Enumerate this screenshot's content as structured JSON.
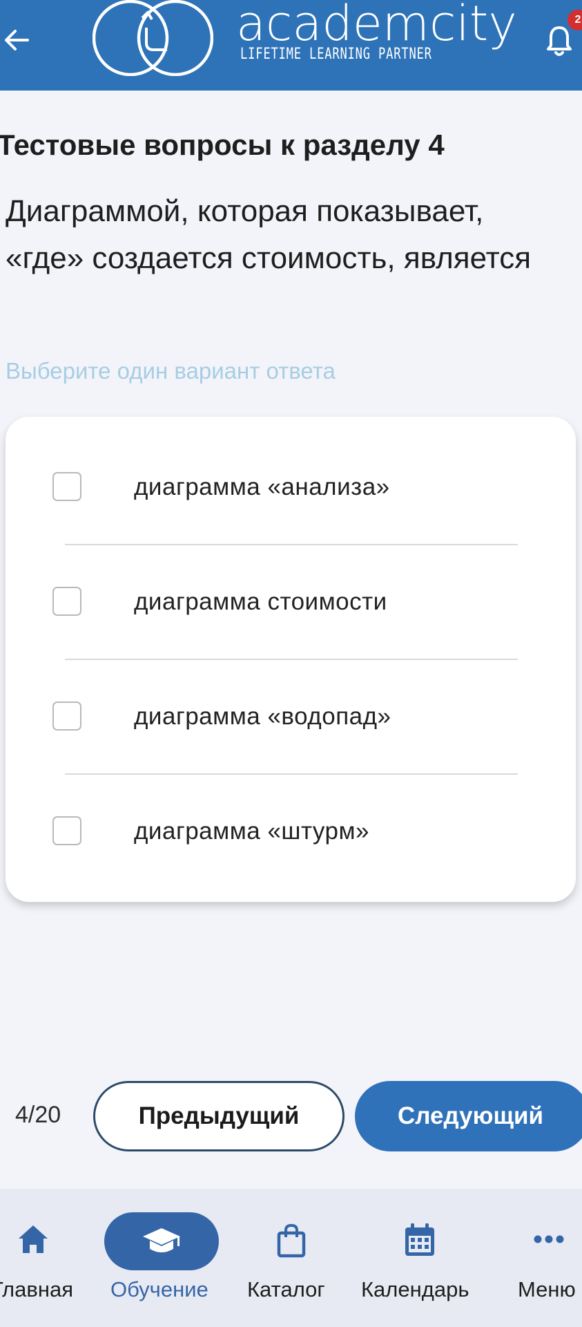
{
  "header": {
    "brand_name": "academcity",
    "brand_tagline": "LIFETIME LEARNING PARTNER",
    "notification_count": "2"
  },
  "quiz": {
    "section_title": "Тестовые вопросы к разделу 4",
    "question": "Диаграммой, которая показывает, «где» создается стоимость, является",
    "hint": "Выберите один вариант ответа",
    "options": [
      {
        "label": "диаграмма «анализа»",
        "checked": false
      },
      {
        "label": "диаграмма стоимости",
        "checked": false
      },
      {
        "label": "диаграмма «водопад»",
        "checked": false
      },
      {
        "label": "диаграмма «штурм»",
        "checked": false
      }
    ],
    "progress": "4/20",
    "prev_label": "Предыдущий",
    "next_label": "Следующий"
  },
  "nav": {
    "items": [
      {
        "label": "Главная",
        "icon": "home-icon",
        "active": false
      },
      {
        "label": "Обучение",
        "icon": "graduation-cap-icon",
        "active": true
      },
      {
        "label": "Каталог",
        "icon": "shopping-bag-icon",
        "active": false
      },
      {
        "label": "Календарь",
        "icon": "calendar-icon",
        "active": false
      },
      {
        "label": "Меню",
        "icon": "more-dots-icon",
        "active": false
      }
    ]
  },
  "colors": {
    "header_bg": "#2e73b8",
    "accent": "#2f72b9",
    "active_nav": "#3466a7",
    "hint_text": "#a7cde4",
    "badge": "#d32f2f"
  }
}
